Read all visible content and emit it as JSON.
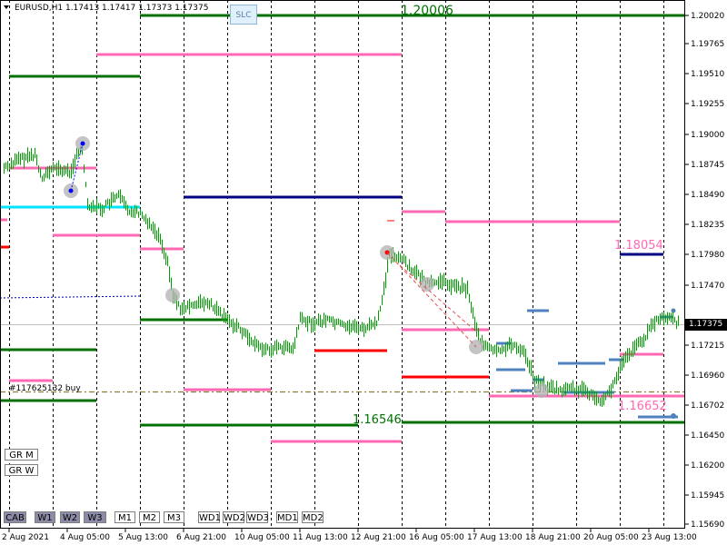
{
  "symbol_info": "EURUSD,H1  1.17413 1.17417 1.17373 1.17375",
  "slc_label": "SLC",
  "current_price": "1.17375",
  "order_label": "#117625132 buy",
  "level_labels": {
    "top": "1.20006",
    "bottom": "1.16546",
    "right_a": "1.18054",
    "right_b": "1.16652"
  },
  "price_axis": [
    "1.20020",
    "1.19765",
    "1.19510",
    "1.19255",
    "1.19000",
    "1.18745",
    "1.18490",
    "1.18235",
    "1.17980",
    "1.17470",
    "1.17215",
    "1.16960",
    "1.16702",
    "1.16450",
    "1.16200",
    "1.15945",
    "1.15690"
  ],
  "time_axis": [
    "2 Aug 2021",
    "4 Aug 05:00",
    "5 Aug 13:00",
    "6 Aug 21:00",
    "10 Aug 05:00",
    "11 Aug 13:00",
    "12 Aug 21:00",
    "16 Aug 05:00",
    "17 Aug 13:00",
    "18 Aug 21:00",
    "20 Aug 05:00",
    "23 Aug 13:00"
  ],
  "grid_buttons": [
    "GR M",
    "GR W"
  ],
  "timeframe_buttons": [
    {
      "label": "CAB",
      "active": true
    },
    {
      "label": "W1",
      "active": true
    },
    {
      "label": "W2",
      "active": true
    },
    {
      "label": "W3",
      "active": true
    },
    {
      "label": "M1",
      "active": false
    },
    {
      "label": "M2",
      "active": false
    },
    {
      "label": "M3",
      "active": false
    },
    {
      "label": "WD1",
      "active": false
    },
    {
      "label": "WD2",
      "active": false
    },
    {
      "label": "WD3",
      "active": false
    },
    {
      "label": "MD1",
      "active": false
    },
    {
      "label": "MD2",
      "active": false
    }
  ],
  "colors": {
    "green": "#007000",
    "pink": "#ff69b4",
    "navy": "#000080",
    "red": "#ff0000",
    "cyan": "#00e5ff",
    "steel": "#4f81bd",
    "candle": "#00a000"
  }
}
